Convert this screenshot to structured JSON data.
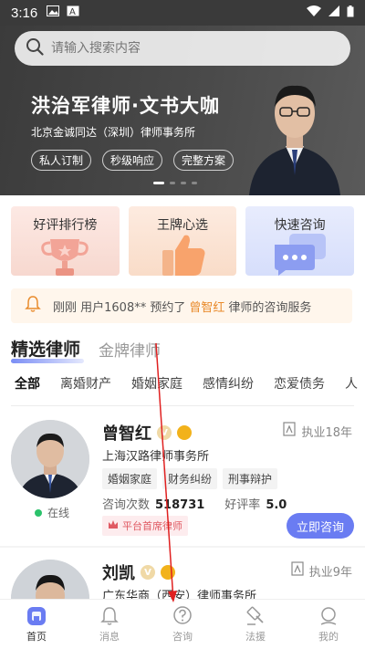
{
  "status_bar": {
    "time": "3:16"
  },
  "search": {
    "placeholder": "请输入搜索内容"
  },
  "banner": {
    "title": "洪治军律师·文书大咖",
    "subtitle": "北京金诚同达（深圳）律师事务所",
    "tags": [
      "私人订制",
      "秒级响应",
      "完整方案"
    ],
    "slide_index": 1,
    "slide_count": 4
  },
  "quick_cards": [
    {
      "label": "好评排行榜",
      "icon": "trophy-icon"
    },
    {
      "label": "王牌心选",
      "icon": "thumbs-up-icon"
    },
    {
      "label": "快速咨询",
      "icon": "chat-bubble-icon"
    }
  ],
  "notice": {
    "prefix": "刚刚 用户1608** 预约了",
    "lawyer": "曾智红",
    "suffix": "律师的咨询服务"
  },
  "section_tabs": {
    "active": "精选律师",
    "inactive": "金牌律师"
  },
  "categories": [
    "全部",
    "离婚财产",
    "婚姻家庭",
    "感情纠纷",
    "恋爱债务",
    "人"
  ],
  "lawyers": [
    {
      "name": "曾智红",
      "experience": "执业18年",
      "firm": "上海汉路律师事务所",
      "tags": [
        "婚姻家庭",
        "财务纠纷",
        "刑事辩护"
      ],
      "consult_label": "咨询次数",
      "consult_count": "518731",
      "rating_label": "好评率",
      "rating": "5.0",
      "status": "在线",
      "recommend": "平台首席律师",
      "button": "立即咨询"
    },
    {
      "name": "刘凯",
      "experience": "执业9年",
      "firm": "广东华商（西安）律师事务所"
    }
  ],
  "tabbar": [
    {
      "label": "首页",
      "icon": "home-icon",
      "active": true
    },
    {
      "label": "消息",
      "icon": "bell-icon",
      "active": false
    },
    {
      "label": "咨询",
      "icon": "question-icon",
      "active": false
    },
    {
      "label": "法援",
      "icon": "gavel-icon",
      "active": false
    },
    {
      "label": "我的",
      "icon": "profile-icon",
      "active": false
    }
  ],
  "colors": {
    "accent": "#6a7cf2",
    "highlight": "#e98b2c",
    "online": "#2bc26b",
    "banner_bg": "#444444",
    "annotation": "#e02020"
  }
}
